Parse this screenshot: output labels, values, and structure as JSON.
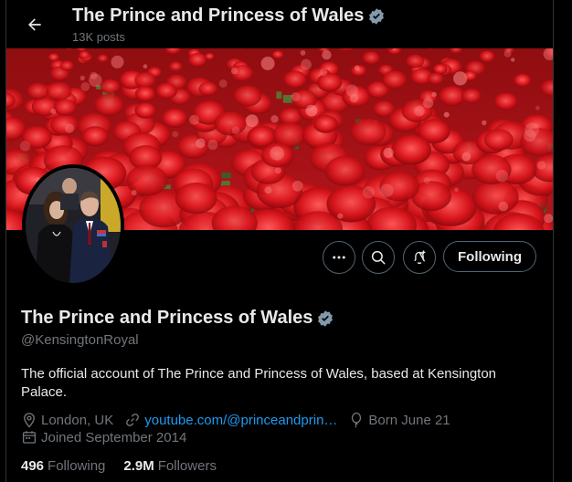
{
  "header": {
    "title": "The Prince and Princess of Wales",
    "posts_count": "13K posts"
  },
  "profile": {
    "name": "The Prince and Princess of Wales",
    "handle": "@KensingtonRoyal",
    "bio": "The official account of The Prince and Princess of Wales, based at Kensington Palace.",
    "location": "London, UK",
    "website": "youtube.com/@princeandprin…",
    "birthday": "Born June 21",
    "joined": "Joined September 2014",
    "following_count": "496",
    "following_label": "Following",
    "followers_count": "2.9M",
    "followers_label": "Followers"
  },
  "actions": {
    "following_button": "Following"
  },
  "icons": {
    "back": "arrow-left-icon",
    "verified": "verified-badge-icon",
    "more": "more-icon",
    "search": "search-icon",
    "notify": "bell-plus-icon",
    "location": "location-pin-icon",
    "link": "link-icon",
    "birthday": "balloon-icon",
    "calendar": "calendar-icon"
  },
  "colors": {
    "background": "#000000",
    "text_primary": "#e7e9ea",
    "text_secondary": "#71767b",
    "link": "#1d9bf0",
    "verified_badge": "#829aab",
    "banner_red": "#c8161e"
  }
}
